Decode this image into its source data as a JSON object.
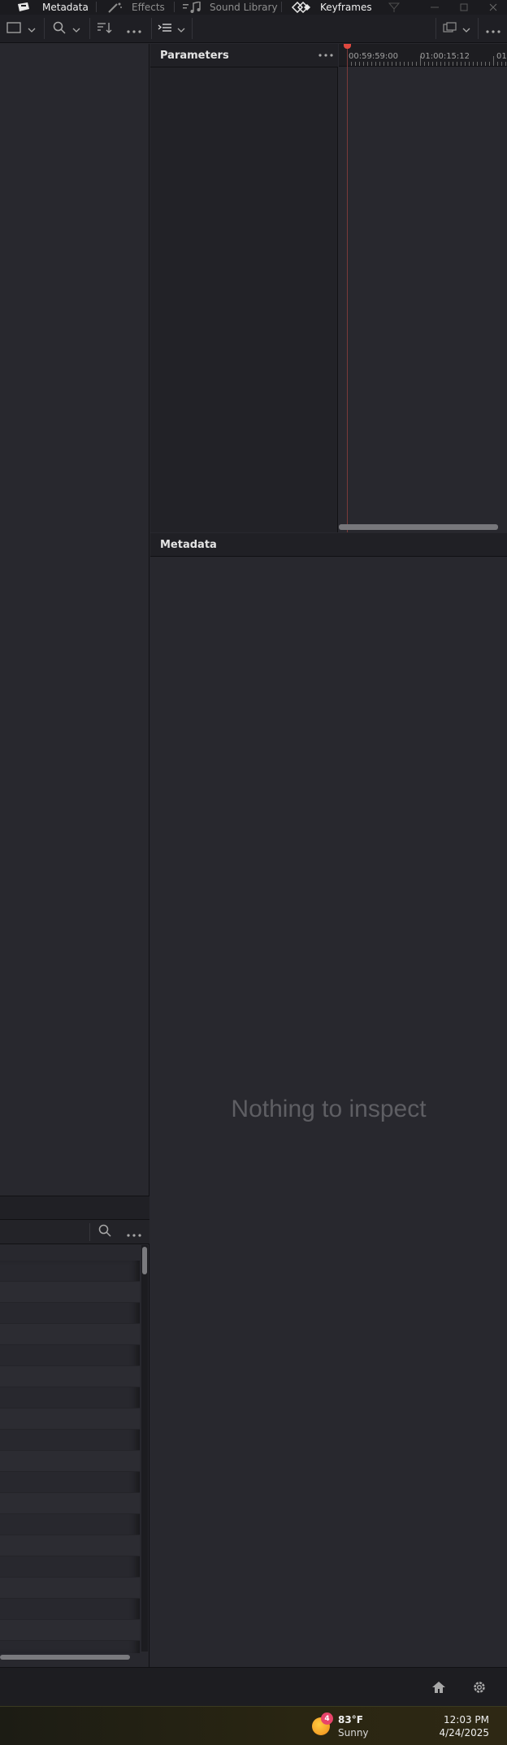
{
  "tabs": [
    {
      "label": "Metadata",
      "active": true,
      "icon": "metadata-icon"
    },
    {
      "label": "Effects",
      "active": false,
      "icon": "effects-wand-icon"
    },
    {
      "label": "Sound Library",
      "active": false,
      "icon": "sound-library-icon"
    },
    {
      "label": "Keyframes",
      "active": true,
      "icon": "keyframes-icon"
    }
  ],
  "parameters": {
    "title": "Parameters"
  },
  "timeline": {
    "ruler_labels": [
      "00:59:59:00",
      "01:00:15:12",
      "01"
    ]
  },
  "metadata": {
    "title": "Metadata",
    "empty_message": "Nothing to inspect"
  },
  "taskbar": {
    "weather_badge": "4",
    "temperature": "83°F",
    "condition": "Sunny",
    "time": "12:03 PM",
    "date": "4/24/2025"
  },
  "colors": {
    "accent_playhead": "#e0483f",
    "panel_bg": "#28282e",
    "header_bg": "#202025"
  }
}
